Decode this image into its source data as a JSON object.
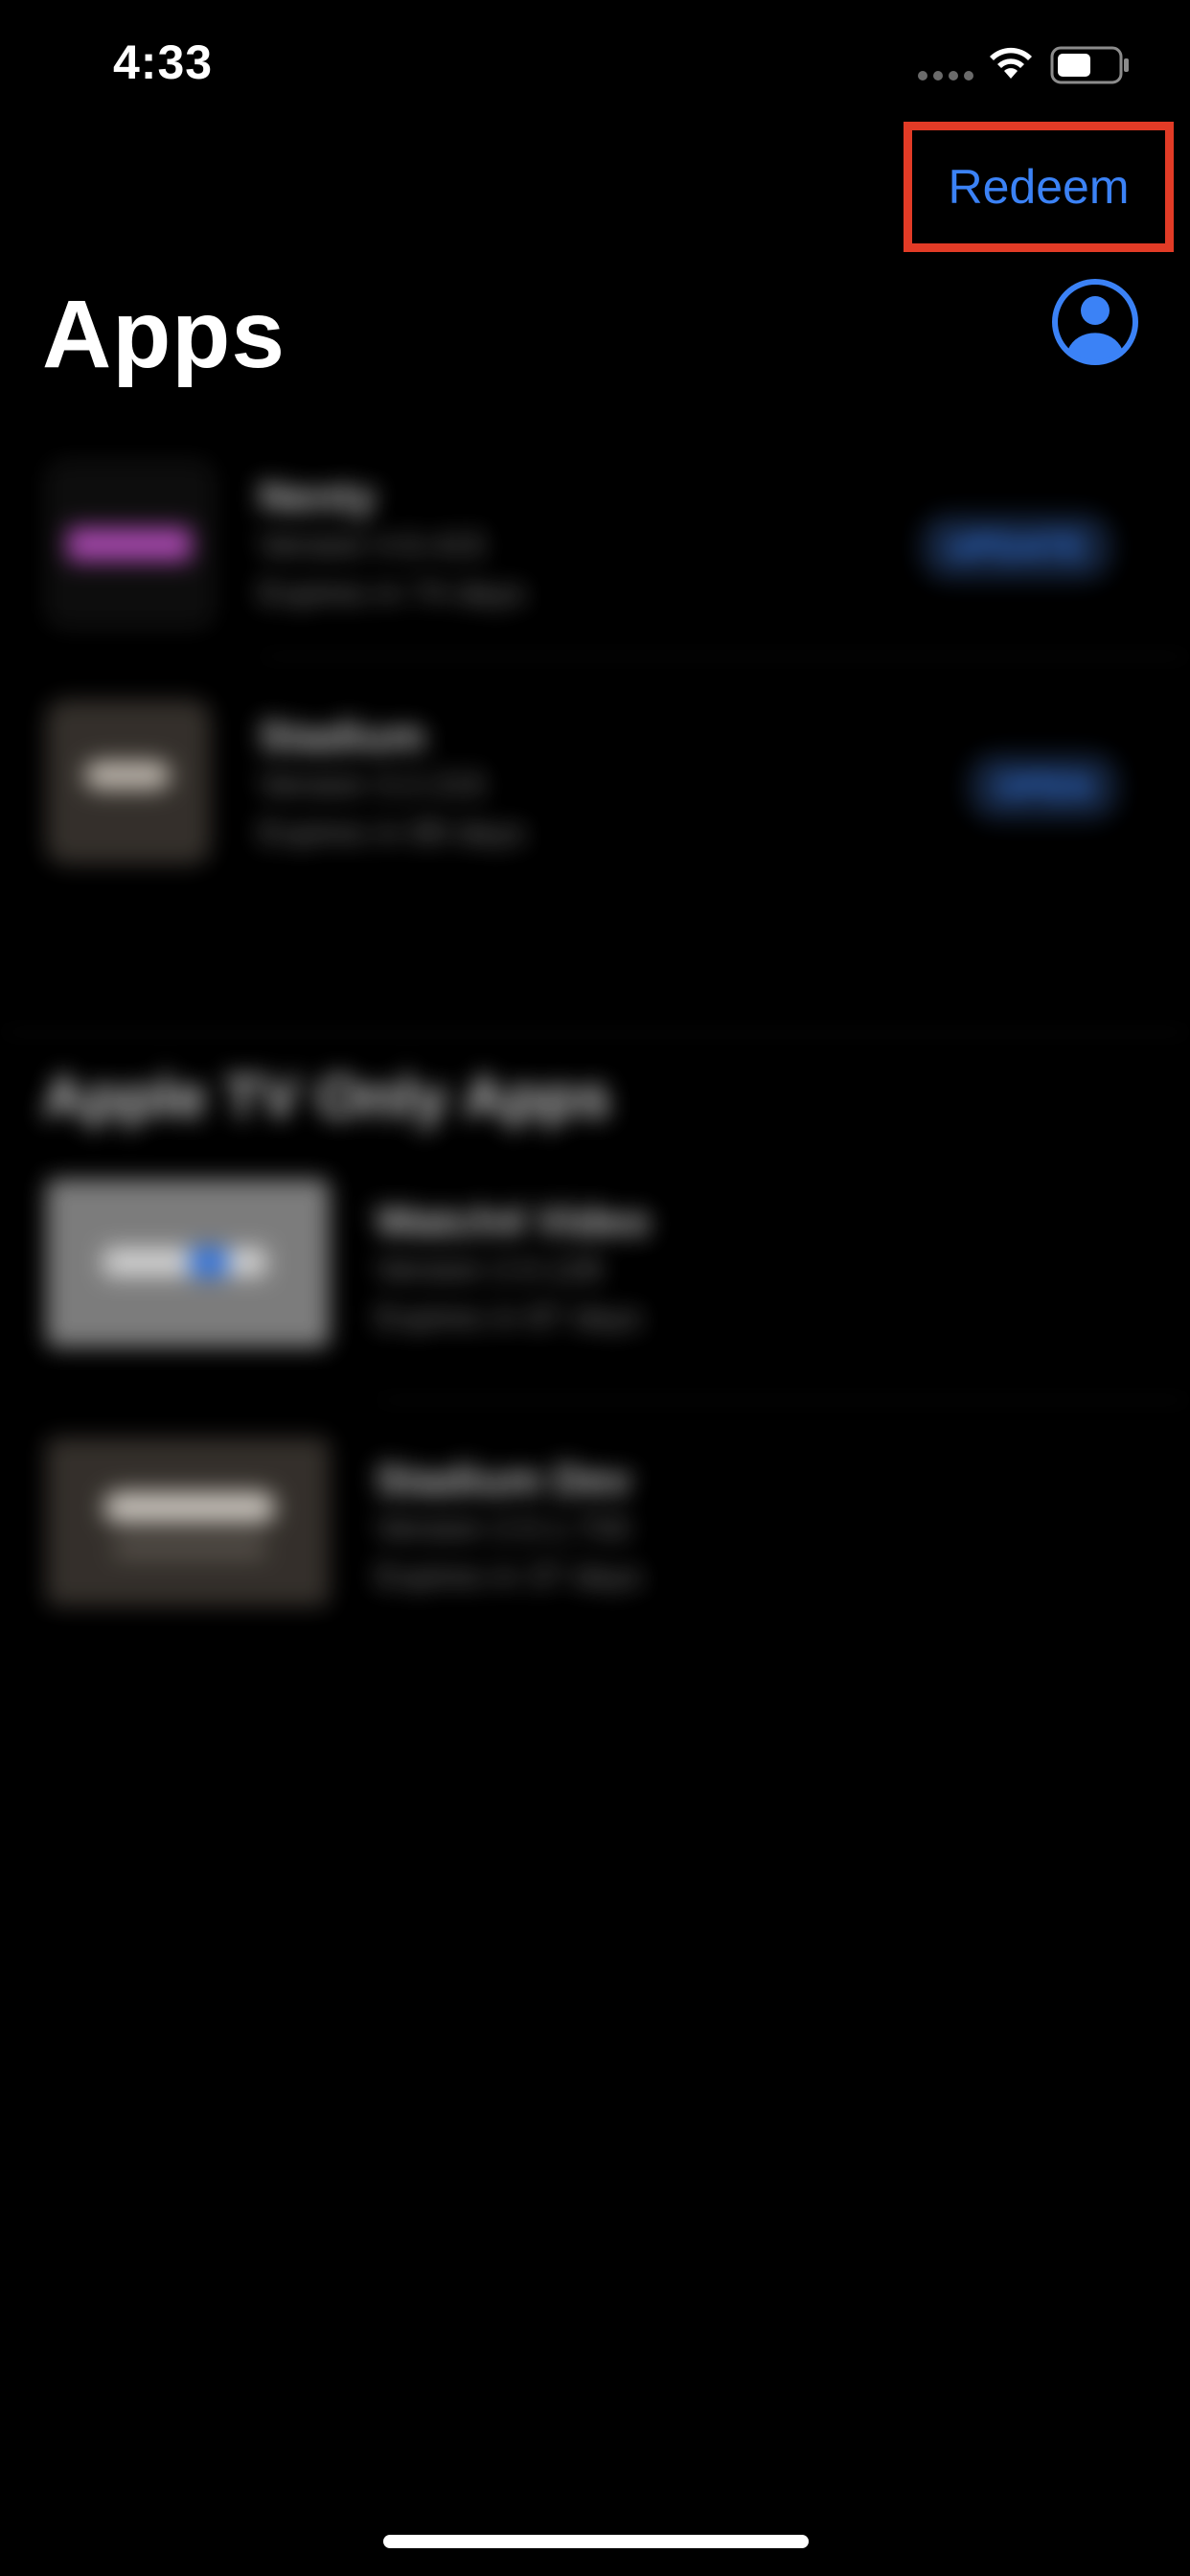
{
  "status_bar": {
    "time": "4:33",
    "icons": [
      "cellular-icon",
      "wifi-icon",
      "battery-icon"
    ]
  },
  "nav": {
    "redeem_label": "Redeem",
    "highlight_color": "#e23b26",
    "accent_color": "#3b82f6"
  },
  "title": "Apps",
  "apps": [
    {
      "name": "Nenty",
      "version": "Version 4.6.415",
      "expires": "Expires in 74 days",
      "action": "UPDATE"
    },
    {
      "name": "Stadium",
      "version": "Version 3.2.215",
      "expires": "Expires in 89 days",
      "action": "OPEN"
    }
  ],
  "section_title": "Apple TV Only Apps",
  "tv_apps": [
    {
      "name": "Watch4 Video",
      "version": "Version 2.0.128",
      "expires": "Expires in 87 days"
    },
    {
      "name": "Stadium Dev",
      "version": "Version 2.0.1.733",
      "expires": "Expires in 37 days"
    }
  ]
}
